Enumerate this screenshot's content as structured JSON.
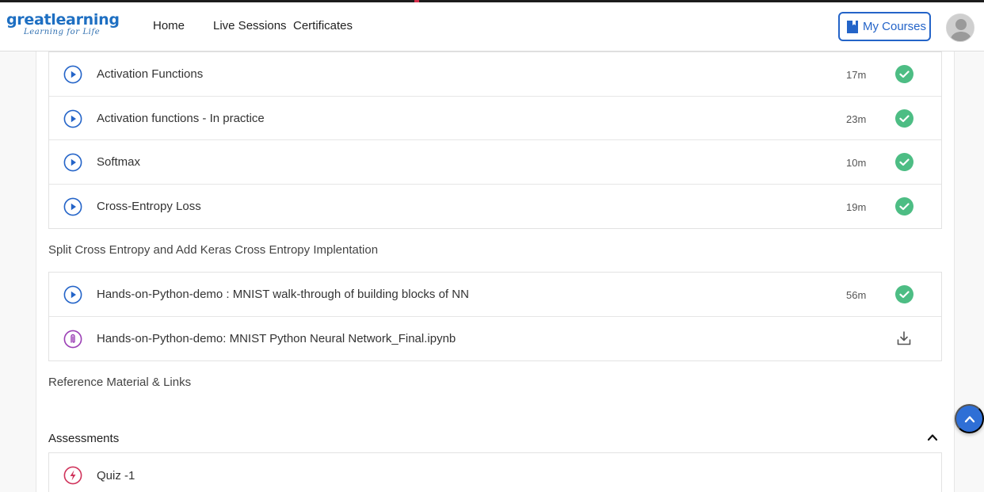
{
  "header": {
    "logo_main": "greatlearning",
    "logo_sub": "Learning for Life",
    "nav": [
      "Home",
      "Live Sessions",
      "Certificates"
    ],
    "my_courses_label": "My Courses"
  },
  "lessons_group_1": [
    {
      "title": "Activation Functions",
      "duration": "17m",
      "type": "video",
      "completed": true
    },
    {
      "title": "Activation functions - In practice",
      "duration": "23m",
      "type": "video",
      "completed": true
    },
    {
      "title": "Softmax",
      "duration": "10m",
      "type": "video",
      "completed": true
    },
    {
      "title": "Cross-Entropy Loss",
      "duration": "19m",
      "type": "video",
      "completed": true
    }
  ],
  "section_split": "Split Cross Entropy and Add Keras Cross Entropy Implentation",
  "lessons_group_2": [
    {
      "title": "Hands-on-Python-demo : MNIST walk-through of building blocks of NN",
      "duration": "56m",
      "type": "video",
      "completed": true
    },
    {
      "title": "Hands-on-Python-demo: MNIST Python Neural Network_Final.ipynb",
      "type": "attachment"
    }
  ],
  "section_reference": "Reference Material & Links",
  "assessments": {
    "heading": "Assessments",
    "items": [
      {
        "title": "Quiz -1",
        "type": "quiz"
      }
    ]
  },
  "colors": {
    "brand_blue": "#2464c8",
    "check_green": "#4dbd84",
    "attachment_purple": "#9b3fb5",
    "quiz_red": "#d0335b"
  },
  "icons": {
    "video": "play-circle-icon",
    "attachment": "paperclip-icon",
    "quiz": "lightning-icon",
    "completed": "check-circle-icon",
    "download": "download-icon",
    "scroll_top": "chevron-up-icon"
  }
}
